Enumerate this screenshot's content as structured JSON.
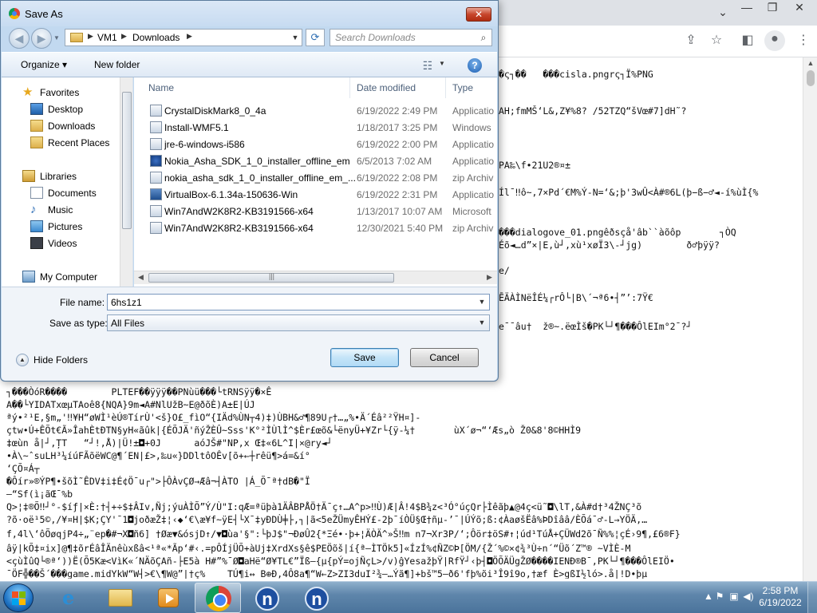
{
  "dialog": {
    "title": "Save As",
    "address": {
      "crumbs": [
        "VM1",
        "Downloads"
      ]
    },
    "search_placeholder": "Search Downloads",
    "toolbar": {
      "organize": "Organize ▾",
      "new_folder": "New folder"
    },
    "nav": {
      "favorites": "Favorites",
      "desktop": "Desktop",
      "downloads": "Downloads",
      "recent_places": "Recent Places",
      "libraries": "Libraries",
      "documents": "Documents",
      "music": "Music",
      "pictures": "Pictures",
      "videos": "Videos",
      "my_computer": "My Computer"
    },
    "columns": {
      "name": "Name",
      "date": "Date modified",
      "type": "Type"
    },
    "files": [
      {
        "name": "CrystalDiskMark8_0_4a",
        "date": "6/19/2022 2:49 PM",
        "type": "Applicatio"
      },
      {
        "name": "Install-WMF5.1",
        "date": "1/18/2017 3:25 PM",
        "type": "Windows"
      },
      {
        "name": "jre-6-windows-i586",
        "date": "6/19/2022 2:00 PM",
        "type": "Applicatio"
      },
      {
        "name": "Nokia_Asha_SDK_1_0_installer_offline_em",
        "date": "6/5/2013 7:02 AM",
        "type": "Applicatio"
      },
      {
        "name": "nokia_asha_sdk_1_0_installer_offline_em_...",
        "date": "6/19/2022 2:08 PM",
        "type": "zip Archiv"
      },
      {
        "name": "VirtualBox-6.1.34a-150636-Win",
        "date": "6/19/2022 2:31 PM",
        "type": "Applicatio"
      },
      {
        "name": "Win7AndW2K8R2-KB3191566-x64",
        "date": "1/13/2017 10:07 AM",
        "type": "Microsoft"
      },
      {
        "name": "Win7AndW2K8R2-KB3191566-x64",
        "date": "12/30/2021 5:40 PM",
        "type": "zip Archiv"
      }
    ],
    "file_name_label": "File name:",
    "file_name_value": "6hs1z1",
    "save_type_label": "Save as type:",
    "save_type_value": "All Files",
    "hide_folders": "Hide Folders",
    "save": "Save",
    "cancel": "Cancel"
  },
  "background_text": {
    "lines": [
      "�ς┐��   ���cisla.pngrς┐Ï%PNG",
      "AH;fmMŠ‘L&,Z¥%8? /52TZQ“šVœ#7]dH˜?",
      "PA‰\\f•21U2®¤±",
      "Íl¯‼ô~,7×Pd´€M%Ý-N=‘&;þ'3wÛ<À#®6L(þ−ß−♂◄-í%ùÌ{%",
      "���dialogove_01.pngêðsçå'âb``àõôp       ┐ÒQ",
      "Éõ◄…d”×|E,ù┘,xù¹xøÏ3\\-┘jg)        ð♂þÿÿ?",
      "e/",
      "ĒÄÀÌNëÎÉ¼┌rÔ└|B\\´¬ª6•┤”’:7Ÿ€",
      "e¯¯âu†  ž®~.ëœÌš�PK└┘¶���ÔlEIm°2¯?┘",
      "┐���ÒóR����        PLTEF��ÿÿÿ��PNùü���└tRNSÿÿ�×Ê",
      "A��└YIDATxœµTAoê8{NQA}9m◄A#NlUžB~E@ðõÈ)A±E|ÚJ",
      "ªý•²¹E,§m„'‼¥H“øWÌ¹èÚ®TírÙ'<š}O£_fìO“{IÄd%ÙN┬4)‡)ÙBH&♂¶89U┌†…„%•Ä´Éâ²²ŸH¤]-",
      "çtw•Ú+ÊÕt€Ã»ÎahÈtĐTN§yH«ãûk|{ÉÕJÄ'ñýŽÈÛ~Sss'K°²ÌÙlÌ^$Èr£œõ&└ënyÜ+¥Zr└{ÿ-¼†       ùX´ø¬“‘Æs„ò Ž0&8'8©HHÌ9",
      "‡œùn å|┘,ȚT   “┘!,Å)|Ü!±◘+0J      aóJŠ#\"NP,x Œ‡«6L^I|×@ry◄┘",
      "•À\\~ˆsuLH³¼íúFÃõëWC@¶´EN|£>,‰u«}DDltôOÊv[õ+←┼rêü¶>á=&í°",
      "‘ÇÕ¤Á┬",
      "�Ôír»®ÝP¶•šõÌ˜ÊDV‡i‡É¢Ö¯u┌\">├ÔÀvÇØ→Æâ¬┤ÀTO |Á_Õ¯ª†dB�\"Ï",
      "—“Sf(ì¡ãŒ¯%b",
      "Q>¦‡®Õ‼┘°-$íƒ|×È:†┤+÷$‡ÂIv,Ñj;ýuÀÌÕ”Ý/Ù\"I:qÆ=ªüþà1ÄÂBPÅÖ†Ä¯ç↑…A^p>‼Ù)Æ|Â!4$B¾z<³Ó°úçQr├Ìêãþ▲@4ç<ü˜◘\\lT,&À#d†³4ŽNÇ³õ",
      "?õ·oë¹5©,/¥¤H|$K;ÇY'¯1◘joðæŽ‡¦‹◆‘€\\æ¥f~ÿE┤└X¯‡yÐDÙ╪├,┐|ã<5eŽÜmyÊHÝ£-2þ¯íÒÜ§Œ†ñµ-’¯|ÚÝõ;ß:¢ÀaøšËâ%ÞDîââ/ÈÕá¯♂-L→YÖÄ,…",
      "f,4l\\‘ôÕøqjP4÷„¨ep�#¬X◘ñ6] †Øæ▼&ósjD↑/▼◘ùa'§\":└þJ$\"¬ÐøÛ2{*Ξé•·þ+¦ÄÒÄ^»Š‼m n7¬Xr3P/‘;Ôör‡öS#↑¦úd¹TúÅ+ÇÜWd2õ¯Ñ%%¦çÉ›9¶,£6®F}",
      "âÿ|kÕ‡¤ix]@¶‡õrÉâÎÄnêùxßâ<¹ª«*Ãp‘#‹.=pÔÍjÜÕ+àUj‡XrdXs§ê$PEÖõš|í{ª—ÌTÖk5]«ÍzÍ%¢ÑZ©Þ[ÖM/{Ž´%©×¢¾³Ù÷n´“Üõ´Z™® ~VÌÈ-M",
      "<çùÌûQ└®ª‘))Ë(Õ5Kæ<VìK«´NÄõÇAñ-├E5à H#”%¯Ø◘aHë“Ø¥TL€”Ïß–{µ{pÝ=ojÑçL>/v)ĝYesažþŸ|RfŸ┘‹þ┤◘ÖÕÄÜgŽØ����IENÐ®B¯,PK└┘¶���ÔlEIÖ•",
      "¯ÖF╬��Š´���game.midYkW“W┤>€\\¶W@”|⁠†ç%    TÚ¶i↔ B⊕Đ,4Ô8a¶“W←Z>ZI3duI²¾–…Ýã¶]+bš™5—ð6'fþ%õi³Î9î9o,†æf È>gßI½ló>.å|!D•þµ"
    ]
  },
  "taskbar": {
    "time": "2:58 PM",
    "date": "6/19/2022"
  }
}
